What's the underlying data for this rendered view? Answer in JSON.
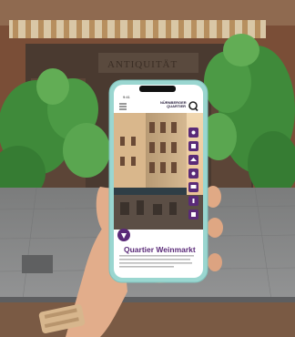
{
  "photo": {
    "shop_sign": "ANTIQUITÄT",
    "phone": {
      "status_time": "9:41",
      "brand_line1": "NÜRNBERGER",
      "brand_line2": "QUARTIER",
      "title": "Quartier Weinmarkt",
      "icons": [
        "menu-icon",
        "search-icon",
        "grape-icon",
        "book-icon",
        "map-icon",
        "share-icon",
        "camera-icon",
        "info-icon"
      ]
    },
    "colors": {
      "phone_case": "#9ad6d0",
      "brand_purple": "#5a2a78",
      "foliage": "#3f8a3a",
      "pavement": "#8a8c8e"
    }
  }
}
